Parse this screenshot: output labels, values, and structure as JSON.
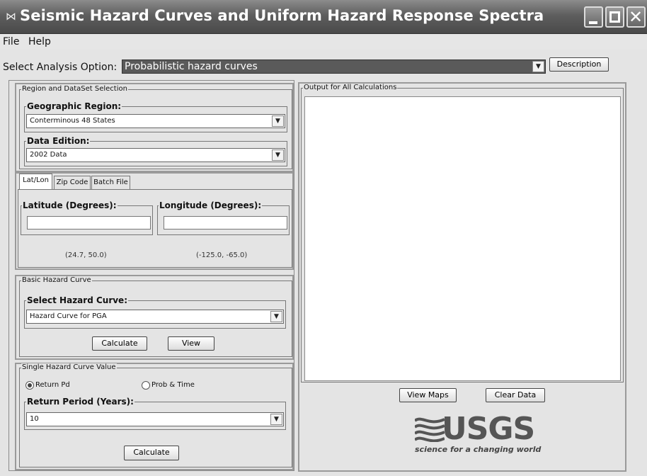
{
  "window": {
    "title": "Seismic Hazard Curves and Uniform Hazard Response Spectra",
    "icon": "app-icon"
  },
  "menu": {
    "file": "File",
    "help": "Help"
  },
  "analysis": {
    "label": "Select Analysis Option:",
    "selected": "Probabilistic hazard curves",
    "description_button": "Description"
  },
  "region_panel": {
    "title": "Region and DataSet Selection",
    "geo_label": "Geographic Region:",
    "geo_value": "Conterminous 48 States",
    "edition_label": "Data Edition:",
    "edition_value": "2002 Data"
  },
  "location_tabs": {
    "tabs": [
      "Lat/Lon",
      "Zip Code",
      "Batch File"
    ],
    "active": "Lat/Lon",
    "latitude_label": "Latitude (Degrees):",
    "latitude_value": "",
    "latitude_range": "(24.7, 50.0)",
    "longitude_label": "Longitude (Degrees):",
    "longitude_value": "",
    "longitude_range": "(-125.0, -65.0)"
  },
  "basic_curve": {
    "title": "Basic Hazard Curve",
    "select_label": "Select Hazard Curve:",
    "select_value": "Hazard Curve for PGA",
    "calculate": "Calculate",
    "view": "View"
  },
  "single_value": {
    "title": "Single Hazard Curve Value",
    "radio_return": "Return Pd",
    "radio_prob": "Prob & Time",
    "selected_radio": "Return Pd",
    "period_label": "Return Period (Years):",
    "period_value": "10",
    "calculate": "Calculate"
  },
  "output": {
    "title": "Output for All Calculations",
    "text": "",
    "view_maps": "View Maps",
    "clear_data": "Clear Data"
  },
  "logo": {
    "word": "USGS",
    "tagline": "science for a changing world"
  }
}
